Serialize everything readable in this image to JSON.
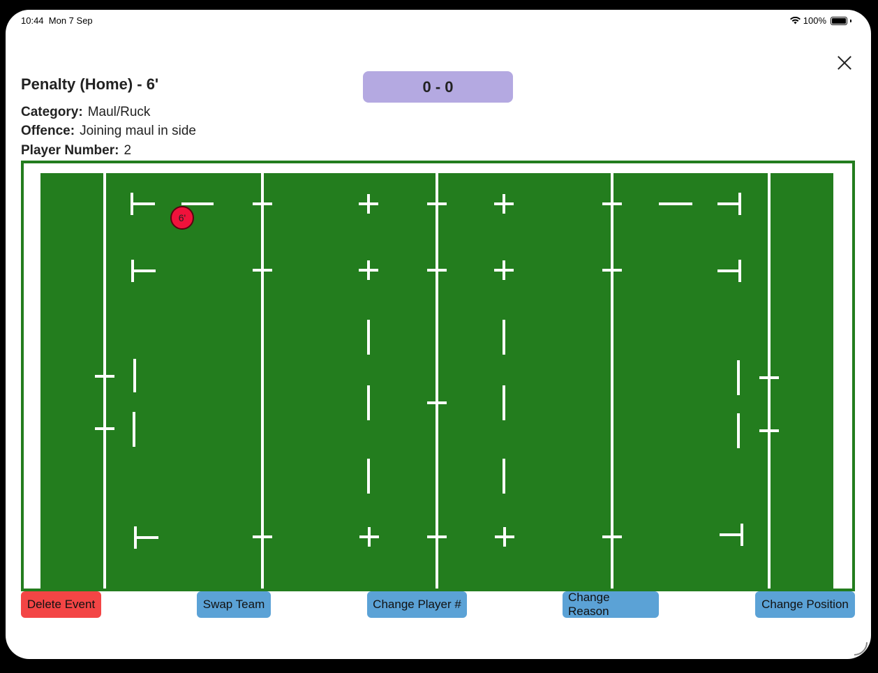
{
  "status": {
    "time": "10:44",
    "date": "Mon 7 Sep",
    "battery": "100%"
  },
  "header": {
    "title": "Penalty (Home) - 6'",
    "score": "0 - 0"
  },
  "details": {
    "category_label": "Category:",
    "category_value": "Maul/Ruck",
    "offence_label": "Offence:",
    "offence_value": "Joining maul in side",
    "player_label": "Player Number:",
    "player_value": "2"
  },
  "field": {
    "color": "#237d1e",
    "line_color": "#ffffff",
    "marker_label": "6'",
    "marker_color": "#f0123b"
  },
  "actions": {
    "delete": "Delete Event",
    "swap": "Swap Team",
    "change_player": "Change Player #",
    "change_reason": "Change Reason",
    "change_position": "Change Position"
  }
}
